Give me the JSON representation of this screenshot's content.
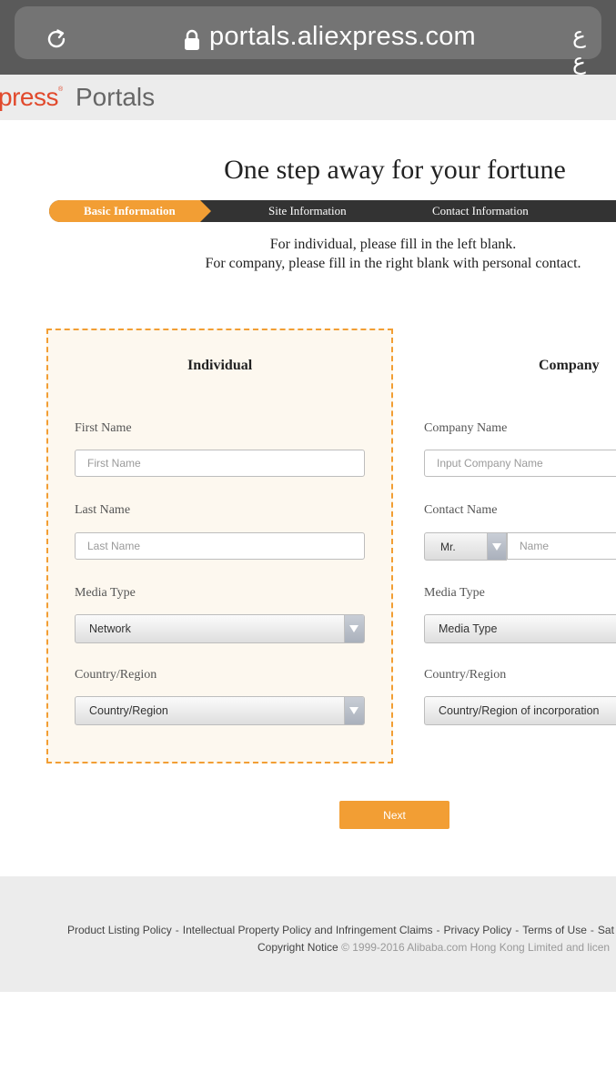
{
  "browser": {
    "url": "portals.aliexpress.com",
    "reader_glyph": "ع ع"
  },
  "header": {
    "brand_partial": "press",
    "registered_mark": "®",
    "portals": "Portals"
  },
  "page": {
    "title": "One step away for your fortune"
  },
  "steps": [
    {
      "label": "Basic Information",
      "active": true
    },
    {
      "label": "Site Information",
      "active": false
    },
    {
      "label": "Contact Information",
      "active": false
    }
  ],
  "instructions": {
    "line1": "For individual, please fill in the left blank.",
    "line2": "For company, please fill in the right blank with personal contact."
  },
  "individual": {
    "title": "Individual",
    "first_name_label": "First Name",
    "first_name_placeholder": "First Name",
    "last_name_label": "Last Name",
    "last_name_placeholder": "Last Name",
    "media_type_label": "Media Type",
    "media_type_value": "Network",
    "country_label": "Country/Region",
    "country_value": "Country/Region"
  },
  "company": {
    "title": "Company",
    "company_name_label": "Company Name",
    "company_name_placeholder": "Input Company Name",
    "contact_name_label": "Contact Name",
    "salutation_value": "Mr.",
    "contact_name_placeholder": "Name",
    "media_type_label": "Media Type",
    "media_type_value": "Media Type",
    "country_label": "Country/Region",
    "country_value": "Country/Region of incorporation"
  },
  "actions": {
    "next_label": "Next"
  },
  "footer": {
    "links": [
      "Product Listing Policy",
      "Intellectual Property Policy and Infringement Claims",
      "Privacy Policy",
      "Terms of Use",
      "Sat"
    ],
    "separator": "-",
    "copyright_link": "Copyright Notice",
    "copyright_text": "© 1999-2016 Alibaba.com Hong Kong Limited and licen"
  },
  "colors": {
    "accent": "#f29e34",
    "brand": "#e14a2d",
    "step_rail": "#333333",
    "panel_bg": "#fdf8ef"
  }
}
